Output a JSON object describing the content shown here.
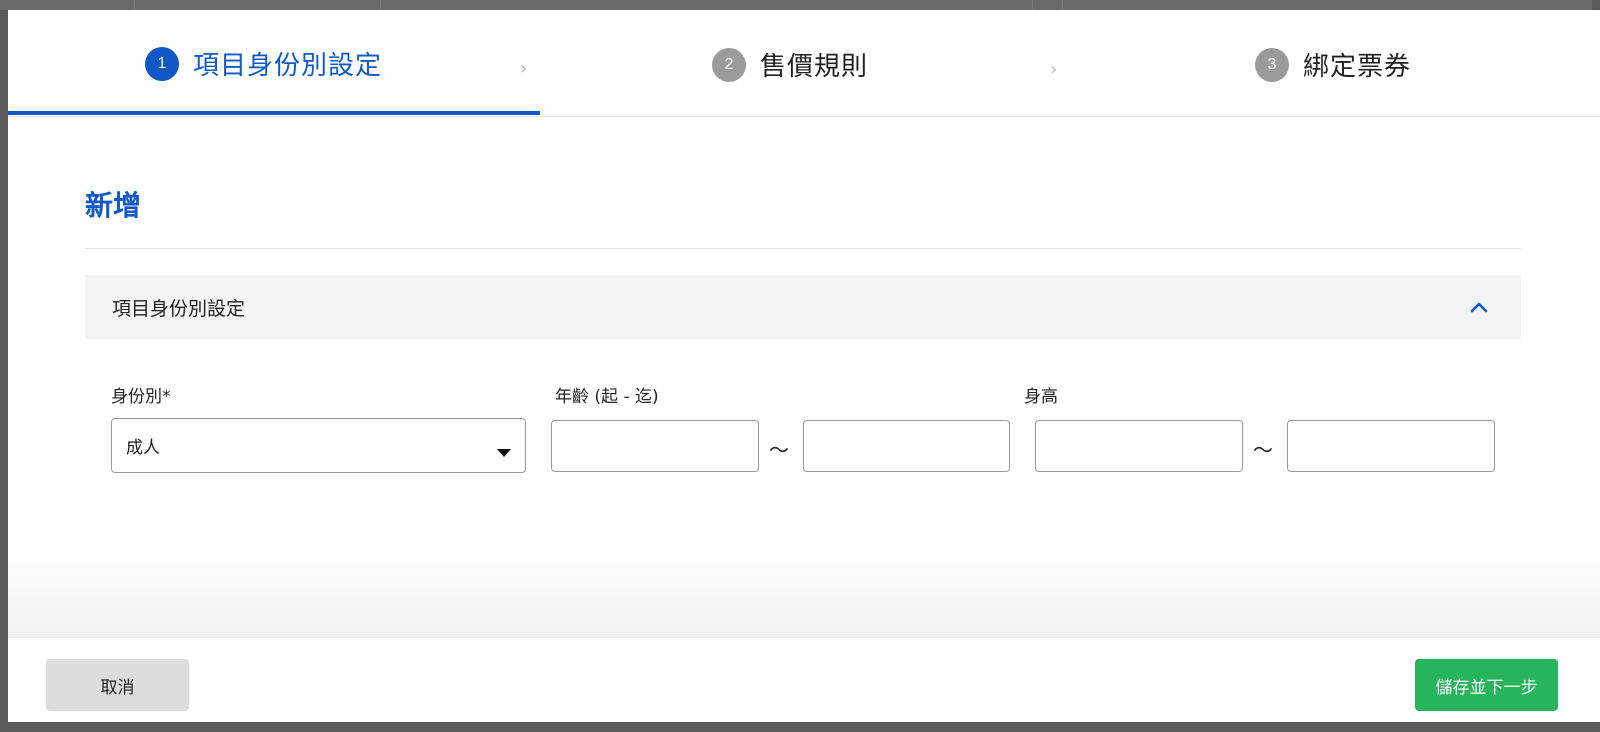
{
  "stepper": {
    "steps": [
      {
        "number": "1",
        "label": "項目身份別設定",
        "state": "active"
      },
      {
        "number": "2",
        "label": "售價規則",
        "state": "inactive"
      },
      {
        "number": "3",
        "label": "綁定票券",
        "state": "inactive"
      }
    ],
    "chevron": "›"
  },
  "page": {
    "title": "新增"
  },
  "section": {
    "title": "項目身份別設定",
    "collapse_icon": "chevron-up-icon"
  },
  "form": {
    "identity": {
      "label": "身份別*",
      "value": "成人"
    },
    "age": {
      "label": "年齡 (起 - 迄)",
      "from_value": "",
      "to_value": "",
      "separator": "～"
    },
    "height": {
      "label": "身高",
      "from_value": "",
      "to_value": "",
      "separator": "～"
    }
  },
  "footer": {
    "cancel_label": "取消",
    "next_label": "儲存並下一步"
  },
  "colors": {
    "primary": "#1158c7",
    "success": "#27b45d",
    "inactive_step": "#9b9b9b",
    "section_bg": "#f3f3f3"
  }
}
